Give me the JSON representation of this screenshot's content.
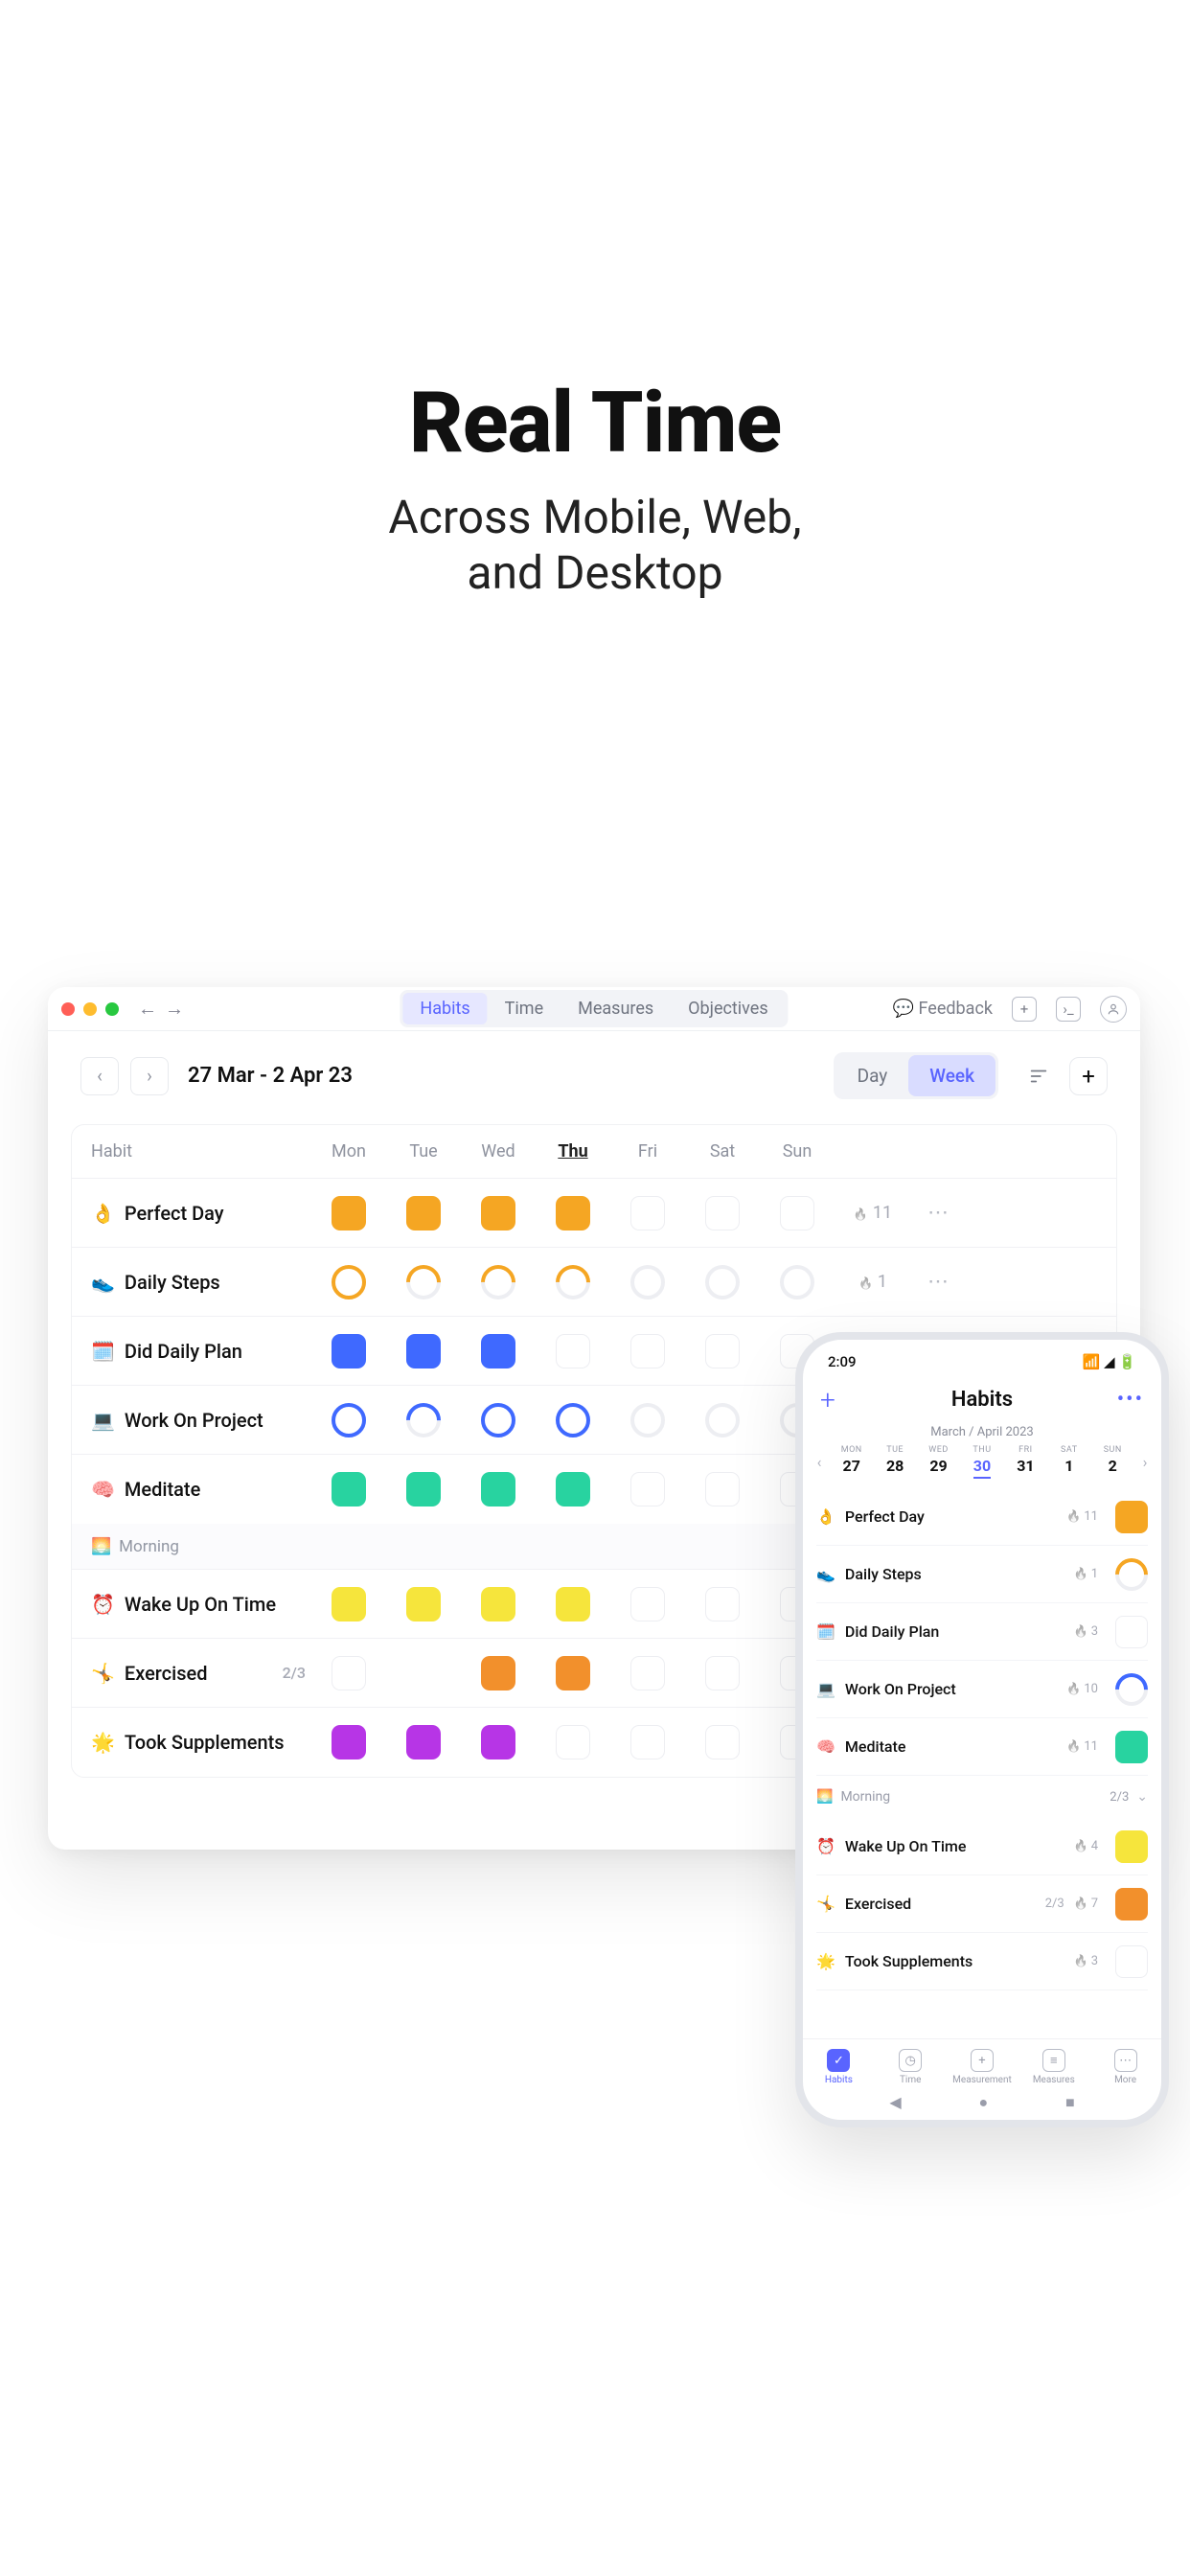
{
  "hero": {
    "title": "Real Time",
    "subtitle_l1": "Across Mobile, Web,",
    "subtitle_l2": "and Desktop"
  },
  "desktop": {
    "tabs": [
      "Habits",
      "Time",
      "Measures",
      "Objectives"
    ],
    "active_tab": "Habits",
    "feedback_label": "Feedback",
    "date_range": "27 Mar - 2 Apr 23",
    "view_seg": {
      "day": "Day",
      "week": "Week",
      "active": "Week"
    },
    "columns": {
      "habit": "Habit",
      "days": [
        "Mon",
        "Tue",
        "Wed",
        "Thu",
        "Fri",
        "Sat",
        "Sun"
      ]
    },
    "rows": [
      {
        "emoji": "👌",
        "name": "Perfect Day",
        "type": "square",
        "color": "orange",
        "cells": [
          "fill",
          "fill",
          "fill",
          "fill",
          "empty",
          "empty",
          "empty"
        ],
        "streak": "11"
      },
      {
        "emoji": "👟",
        "name": "Daily Steps",
        "type": "ring",
        "color": "orange",
        "cells": [
          "ring",
          "partial",
          "partial",
          "partial",
          "empty",
          "empty",
          "empty"
        ],
        "streak": "1"
      },
      {
        "emoji": "🗓️",
        "name": "Did Daily Plan",
        "type": "square",
        "color": "blue",
        "cells": [
          "fill",
          "fill",
          "fill",
          "empty",
          "empty",
          "empty",
          "empty"
        ],
        "streak": null
      },
      {
        "emoji": "💻",
        "name": "Work On Project",
        "type": "ring",
        "color": "blue",
        "cells": [
          "ring",
          "partial",
          "ring",
          "ring",
          "empty",
          "empty",
          "empty"
        ],
        "streak": null
      },
      {
        "emoji": "🧠",
        "name": "Meditate",
        "type": "square",
        "color": "teal",
        "cells": [
          "fill",
          "fill",
          "fill",
          "fill",
          "empty",
          "empty",
          "empty"
        ],
        "streak": null
      }
    ],
    "section": {
      "emoji": "🌅",
      "name": "Morning"
    },
    "rows2": [
      {
        "emoji": "⏰",
        "name": "Wake Up On Time",
        "type": "square",
        "color": "yellow",
        "cells": [
          "fill",
          "fill",
          "fill",
          "fill",
          "empty",
          "empty",
          "empty"
        ],
        "streak": null
      },
      {
        "emoji": "🤸",
        "name": "Exercised",
        "sub": "2/3",
        "type": "square",
        "color": "deeporange",
        "cells": [
          "empty",
          "",
          "fill",
          "fill",
          "empty",
          "empty",
          "empty"
        ],
        "streak": null
      },
      {
        "emoji": "🌟",
        "name": "Took Supplements",
        "type": "square",
        "color": "purple",
        "cells": [
          "fill",
          "fill",
          "fill",
          "empty",
          "empty",
          "empty",
          "empty"
        ],
        "streak": null
      }
    ]
  },
  "phone": {
    "time": "2:09",
    "title": "Habits",
    "month": "March / April 2023",
    "days": [
      {
        "dow": "MON",
        "num": "27"
      },
      {
        "dow": "TUE",
        "num": "28"
      },
      {
        "dow": "WED",
        "num": "29"
      },
      {
        "dow": "THU",
        "num": "30",
        "selected": true
      },
      {
        "dow": "FRI",
        "num": "31"
      },
      {
        "dow": "SAT",
        "num": "1"
      },
      {
        "dow": "SUN",
        "num": "2"
      }
    ],
    "items": [
      {
        "emoji": "👌",
        "name": "Perfect Day",
        "streak": "11",
        "mark": "square",
        "color": "orange",
        "filled": true
      },
      {
        "emoji": "👟",
        "name": "Daily Steps",
        "streak": "1",
        "mark": "ring",
        "color": "orange",
        "filled": false
      },
      {
        "emoji": "🗓️",
        "name": "Did Daily Plan",
        "streak": "3",
        "mark": "square",
        "color": "blue",
        "filled": false
      },
      {
        "emoji": "💻",
        "name": "Work On Project",
        "streak": "10",
        "mark": "ring",
        "color": "blue",
        "filled": false
      },
      {
        "emoji": "🧠",
        "name": "Meditate",
        "streak": "11",
        "mark": "square",
        "color": "teal",
        "filled": true
      }
    ],
    "section": {
      "emoji": "🌅",
      "name": "Morning",
      "count": "2/3"
    },
    "items2": [
      {
        "emoji": "⏰",
        "name": "Wake Up On Time",
        "streak": "4",
        "mark": "square",
        "color": "yellow",
        "filled": true
      },
      {
        "emoji": "🤸",
        "name": "Exercised",
        "sub": "2/3",
        "streak": "7",
        "mark": "square",
        "color": "deeporange",
        "filled": true
      },
      {
        "emoji": "🌟",
        "name": "Took Supplements",
        "streak": "3",
        "mark": "square",
        "color": "purple",
        "filled": false
      }
    ],
    "tabs": [
      {
        "label": "Habits",
        "active": true
      },
      {
        "label": "Time"
      },
      {
        "label": "Measurement"
      },
      {
        "label": "Measures"
      },
      {
        "label": "More"
      }
    ]
  }
}
